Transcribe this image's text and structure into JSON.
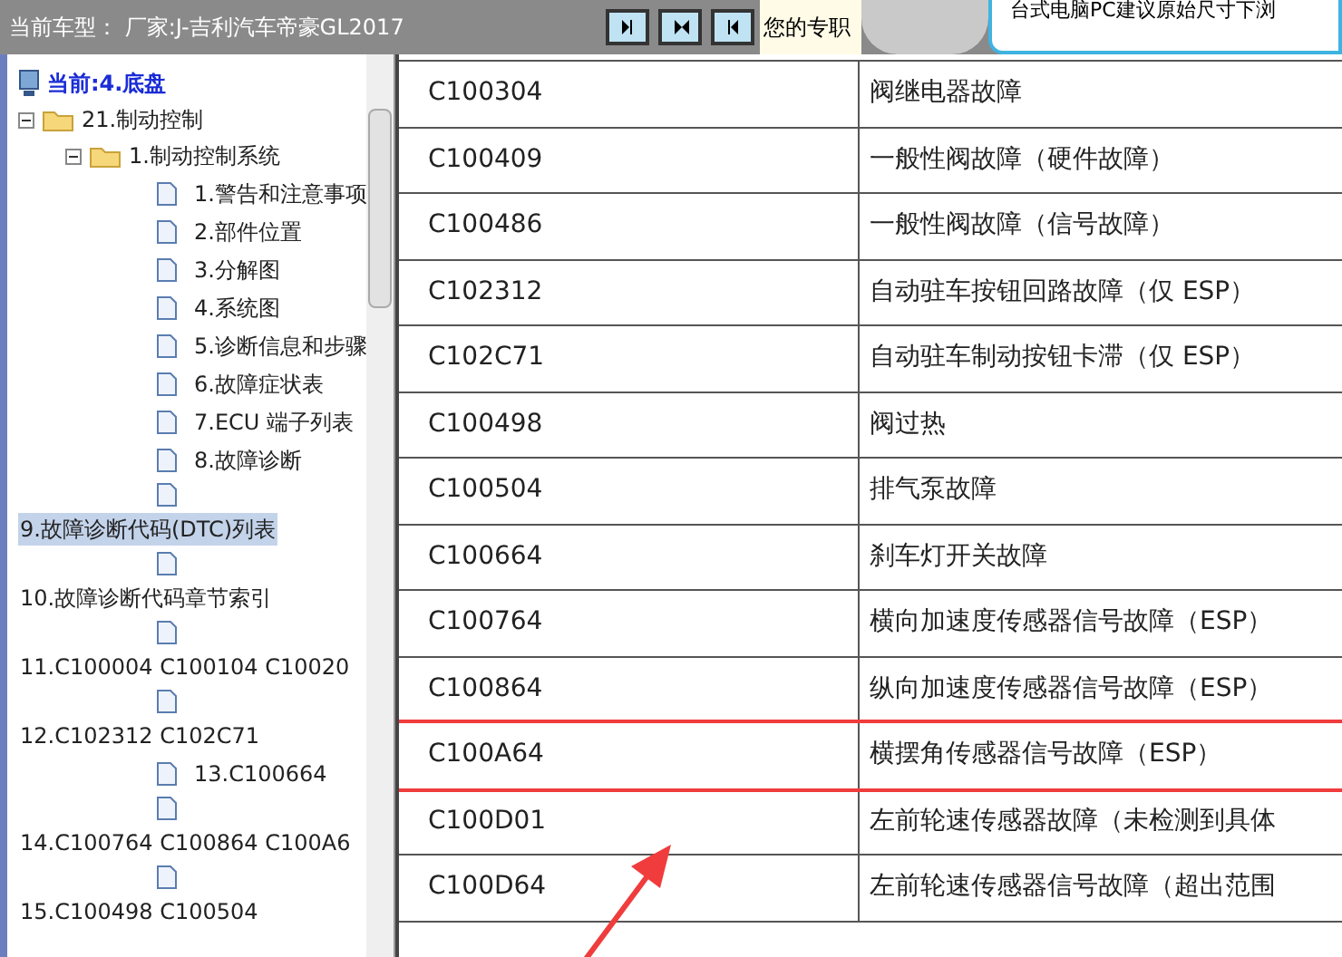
{
  "header": {
    "title": "当前车型： 厂家:J-吉利汽车帝豪GL2017",
    "notice": "您的专职",
    "banner_text": "台式电脑PC建议原始尺寸下浏"
  },
  "sidebar": {
    "current": "当前:4.底盘",
    "tree": [
      {
        "label": "21.制动控制",
        "kind": "folder",
        "expanded": true,
        "children": [
          {
            "label": "1.制动控制系统",
            "kind": "folder",
            "expanded": true,
            "children": [
              {
                "label": "1.警告和注意事项",
                "kind": "doc",
                "wrapped": false,
                "selected": false
              },
              {
                "label": "2.部件位置",
                "kind": "doc",
                "wrapped": false,
                "selected": false
              },
              {
                "label": "3.分解图",
                "kind": "doc",
                "wrapped": false,
                "selected": false
              },
              {
                "label": "4.系统图",
                "kind": "doc",
                "wrapped": false,
                "selected": false
              },
              {
                "label": "5.诊断信息和步骤",
                "kind": "doc",
                "wrapped": false,
                "selected": false
              },
              {
                "label": "6.故障症状表",
                "kind": "doc",
                "wrapped": false,
                "selected": false
              },
              {
                "label": "7.ECU 端子列表",
                "kind": "doc",
                "wrapped": false,
                "selected": false
              },
              {
                "label": "8.故障诊断",
                "kind": "doc",
                "wrapped": false,
                "selected": false
              },
              {
                "label": "9.故障诊断代码(DTC)列表",
                "kind": "doc",
                "wrapped": true,
                "selected": true
              },
              {
                "label": "10.故障诊断代码章节索引",
                "kind": "doc",
                "wrapped": true,
                "selected": false
              },
              {
                "label": "11.C100004 C100104 C10020",
                "kind": "doc",
                "wrapped": true,
                "selected": false
              },
              {
                "label": "12.C102312 C102C71",
                "kind": "doc",
                "wrapped": true,
                "selected": false
              },
              {
                "label": "13.C100664",
                "kind": "doc",
                "wrapped": false,
                "selected": false
              },
              {
                "label": "14.C100764 C100864 C100A6",
                "kind": "doc",
                "wrapped": true,
                "selected": false
              },
              {
                "label": "15.C100498 C100504",
                "kind": "doc",
                "wrapped": true,
                "selected": false
              }
            ]
          }
        ]
      }
    ]
  },
  "table": {
    "rows": [
      {
        "code": "C100304",
        "description": "阀继电器故障",
        "highlighted": false
      },
      {
        "code": "C100409",
        "description": "一般性阀故障（硬件故障）",
        "highlighted": false
      },
      {
        "code": "C100486",
        "description": "一般性阀故障（信号故障）",
        "highlighted": false
      },
      {
        "code": "C102312",
        "description": "自动驻车按钮回路故障（仅 ESP）",
        "highlighted": false
      },
      {
        "code": "C102C71",
        "description": "自动驻车制动按钮卡滞（仅 ESP）",
        "highlighted": false
      },
      {
        "code": "C100498",
        "description": "阀过热",
        "highlighted": false
      },
      {
        "code": "C100504",
        "description": "排气泵故障",
        "highlighted": false
      },
      {
        "code": "C100664",
        "description": "刹车灯开关故障",
        "highlighted": false
      },
      {
        "code": "C100764",
        "description": "横向加速度传感器信号故障（ESP）",
        "highlighted": false
      },
      {
        "code": "C100864",
        "description": "纵向加速度传感器信号故障（ESP）",
        "highlighted": false
      },
      {
        "code": "C100A64",
        "description": "横摆角传感器信号故障（ESP）",
        "highlighted": true
      },
      {
        "code": "C100D01",
        "description": "左前轮速传感器故障（未检测到具体",
        "highlighted": false
      },
      {
        "code": "C100D64",
        "description": "左前轮速传感器信号故障（超出范围",
        "highlighted": false
      }
    ]
  }
}
